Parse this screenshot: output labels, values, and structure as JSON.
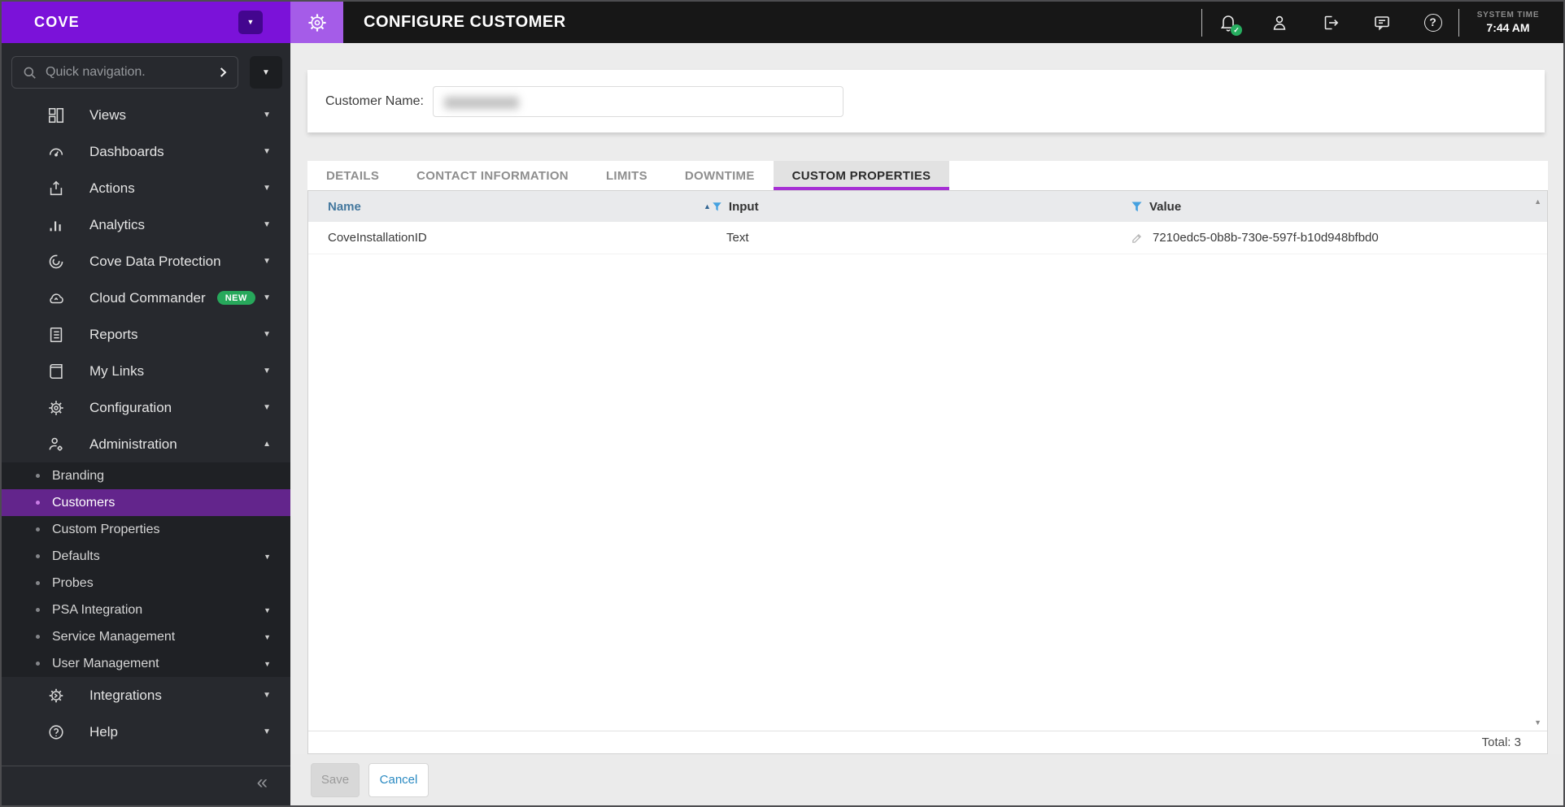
{
  "topbar": {
    "brand": "COVE",
    "title": "CONFIGURE CUSTOMER",
    "system_time_label": "SYSTEM TIME",
    "system_time_value": "7:44 AM",
    "icons": [
      "notifications-bell-checked",
      "user-account",
      "log-out",
      "feedback-chat",
      "help"
    ]
  },
  "sidebar": {
    "search_placeholder": "Quick navigation.",
    "items": [
      {
        "label": "Views"
      },
      {
        "label": "Dashboards"
      },
      {
        "label": "Actions"
      },
      {
        "label": "Analytics"
      },
      {
        "label": "Cove Data Protection"
      },
      {
        "label": "Cloud Commander",
        "badge": "NEW"
      },
      {
        "label": "Reports"
      },
      {
        "label": "My Links"
      },
      {
        "label": "Configuration"
      },
      {
        "label": "Administration",
        "expanded": true
      },
      {
        "label": "Integrations"
      },
      {
        "label": "Help"
      }
    ],
    "admin_subitems": [
      {
        "label": "Branding"
      },
      {
        "label": "Customers",
        "selected": true
      },
      {
        "label": "Custom Properties"
      },
      {
        "label": "Defaults",
        "has_caret": true
      },
      {
        "label": "Probes"
      },
      {
        "label": "PSA Integration",
        "has_caret": true
      },
      {
        "label": "Service Management",
        "has_caret": true
      },
      {
        "label": "User Management",
        "has_caret": true
      }
    ]
  },
  "main": {
    "customer_name_label": "Customer Name:",
    "tabs": [
      {
        "label": "DETAILS"
      },
      {
        "label": "CONTACT INFORMATION"
      },
      {
        "label": "LIMITS"
      },
      {
        "label": "DOWNTIME"
      },
      {
        "label": "CUSTOM PROPERTIES",
        "active": true
      }
    ],
    "table": {
      "columns": [
        "Name",
        "Input",
        "Value"
      ],
      "rows": [
        {
          "name": "CoveInstallationID",
          "input": "Text",
          "value": "7210edc5-0b8b-730e-597f-b10d948bfbd0"
        }
      ],
      "total": "Total: 3"
    },
    "buttons": {
      "save": "Save",
      "cancel": "Cancel"
    }
  },
  "colors": {
    "brand_purple": "#7b12d9",
    "gear_block_purple": "#a55ce8",
    "accent_tab_purple": "#a62fd4",
    "selected_item_purple": "#63258c",
    "new_badge_green": "#27a85b",
    "status_check_green": "#27ae60",
    "filter_blue": "#45a1e0",
    "link_blue": "#2a8ac2"
  }
}
